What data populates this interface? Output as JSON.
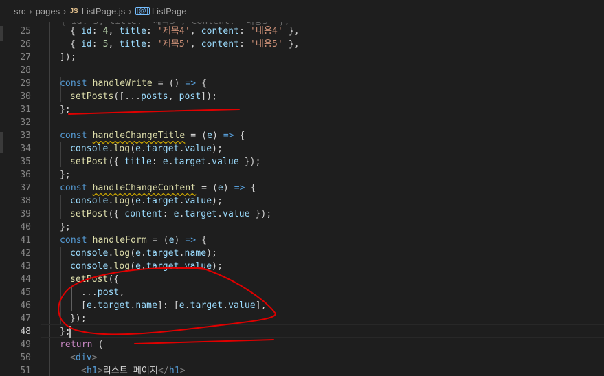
{
  "breadcrumb": {
    "items": [
      "src",
      "pages",
      "ListPage.js",
      "ListPage"
    ],
    "file_badge": "JS",
    "symbol_icon": "[@]"
  },
  "editor": {
    "active_line": "48",
    "lines": [
      {
        "n": "25",
        "t": "{ id: 4, title: '제목4', content: '내용4' },"
      },
      {
        "n": "26",
        "t": "{ id: 5, title: '제목5', content: '내용5' },"
      },
      {
        "n": "27",
        "t": "]);"
      },
      {
        "n": "28",
        "t": ""
      },
      {
        "n": "29",
        "t": "const handleWrite = () => {"
      },
      {
        "n": "30",
        "t": "setPosts([...posts, post]);"
      },
      {
        "n": "31",
        "t": "};"
      },
      {
        "n": "32",
        "t": ""
      },
      {
        "n": "33",
        "t": "const handleChangeTitle = (e) => {"
      },
      {
        "n": "34",
        "t": "console.log(e.target.value);"
      },
      {
        "n": "35",
        "t": "setPost({ title: e.target.value });"
      },
      {
        "n": "36",
        "t": "};"
      },
      {
        "n": "37",
        "t": "const handleChangeContent = (e) => {"
      },
      {
        "n": "38",
        "t": "console.log(e.target.value);"
      },
      {
        "n": "39",
        "t": "setPost({ content: e.target.value });"
      },
      {
        "n": "40",
        "t": "};"
      },
      {
        "n": "41",
        "t": "const handleForm = (e) => {"
      },
      {
        "n": "42",
        "t": "console.log(e.target.name);"
      },
      {
        "n": "43",
        "t": "console.log(e.target.value);"
      },
      {
        "n": "44",
        "t": "setPost({"
      },
      {
        "n": "45",
        "t": "...post,"
      },
      {
        "n": "46",
        "t": "[e.target.name]: [e.target.value],"
      },
      {
        "n": "47",
        "t": "});"
      },
      {
        "n": "48",
        "t": "};"
      },
      {
        "n": "49",
        "t": "return ("
      },
      {
        "n": "50",
        "t": "<div>"
      },
      {
        "n": "51",
        "t": "<h1>리스트 페이지</h1>"
      }
    ]
  },
  "colors": {
    "background": "#1e1e1e",
    "annotation_ink": "#e00000"
  }
}
